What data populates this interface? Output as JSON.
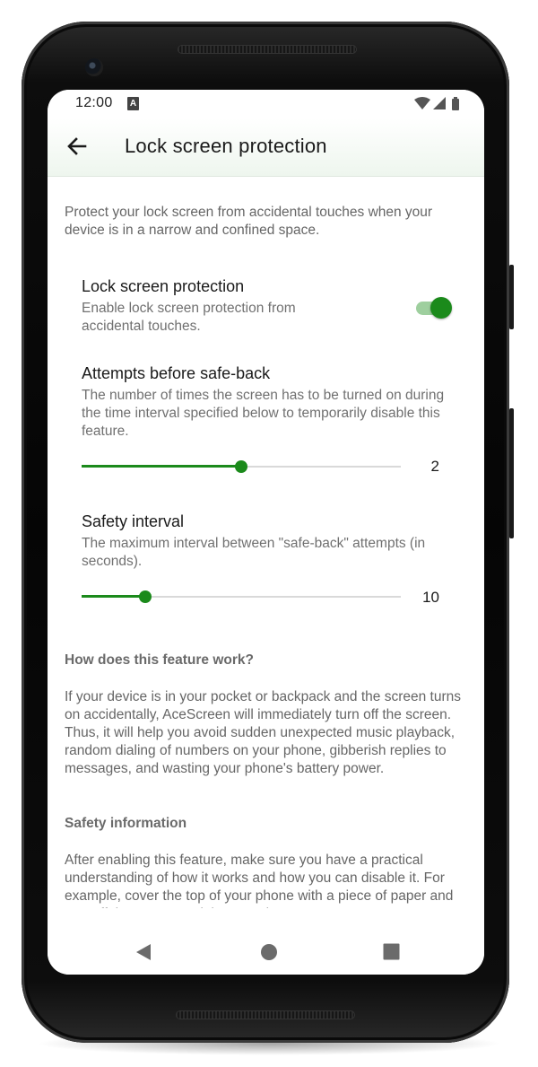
{
  "status_bar": {
    "time": "12:00",
    "notification_glyph": "A",
    "icons": [
      "wifi-icon",
      "signal-icon",
      "battery-icon"
    ]
  },
  "app_bar": {
    "back_icon": "arrow-back-icon",
    "title": "Lock screen protection"
  },
  "intro": "Protect your lock screen from accidental touches when your device is in a narrow and confined space.",
  "preferences": {
    "protection": {
      "title": "Lock screen protection",
      "summary": "Enable lock screen protection from accidental touches.",
      "enabled": true
    },
    "attempts": {
      "title": "Attempts before safe-back",
      "summary": "The number of times the screen has to be turned on during the time interval specified below to temporarily disable this feature.",
      "value": "2",
      "fill_fraction": 0.5
    },
    "interval": {
      "title": "Safety interval",
      "summary": "The maximum interval between \"safe-back\" attempts (in seconds).",
      "value": "10",
      "fill_fraction": 0.2
    }
  },
  "how_it_works": {
    "heading": "How does this feature work?",
    "body": "If your device is in your pocket or backpack and the screen turns on accidentally, AceScreen will immediately turn off the screen. Thus, it will help you avoid sudden unexpected music playback, random dialing of numbers on your phone, gibberish replies to messages, and wasting your phone's battery power."
  },
  "safety_info": {
    "heading": "Safety information",
    "body": "After enabling this feature, make sure you have a practical understanding of how it works and how you can disable it. For example, cover the top of your phone with a piece of paper and turn off the screen and then turn it on."
  },
  "nav_bar": {
    "buttons": [
      "back-triangle-icon",
      "home-circle-icon",
      "recents-square-icon"
    ]
  },
  "colors": {
    "accent": "#1b8a1b",
    "accent_light": "#9ecf9e",
    "app_bar_tint": "#eef6ee",
    "frame": "#0a0a0a"
  }
}
